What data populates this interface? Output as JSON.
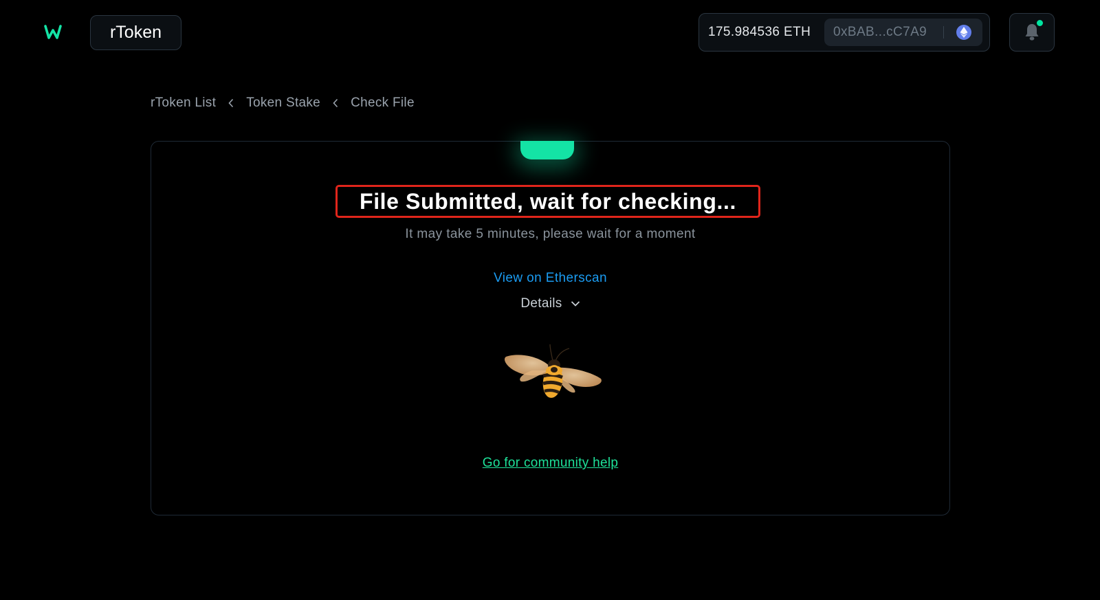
{
  "header": {
    "app_title": "rToken",
    "wallet": {
      "balance": "175.984536 ETH",
      "address": "0xBAB...cC7A9"
    },
    "notification_dot": true
  },
  "breadcrumb": {
    "items": [
      "rToken List",
      "Token Stake",
      "Check File"
    ]
  },
  "status": {
    "title": "File Submitted, wait for checking...",
    "subtitle": "It may take 5 minutes, please wait for a moment",
    "etherscan_link": "View on Etherscan",
    "details_label": "Details",
    "community_link": "Go for community help"
  },
  "colors": {
    "accent": "#14e3a5",
    "link_blue": "#1b9cf2",
    "community_green": "#1ee39a",
    "highlight_border": "#e0251b",
    "eth_icon": "#627eea"
  }
}
